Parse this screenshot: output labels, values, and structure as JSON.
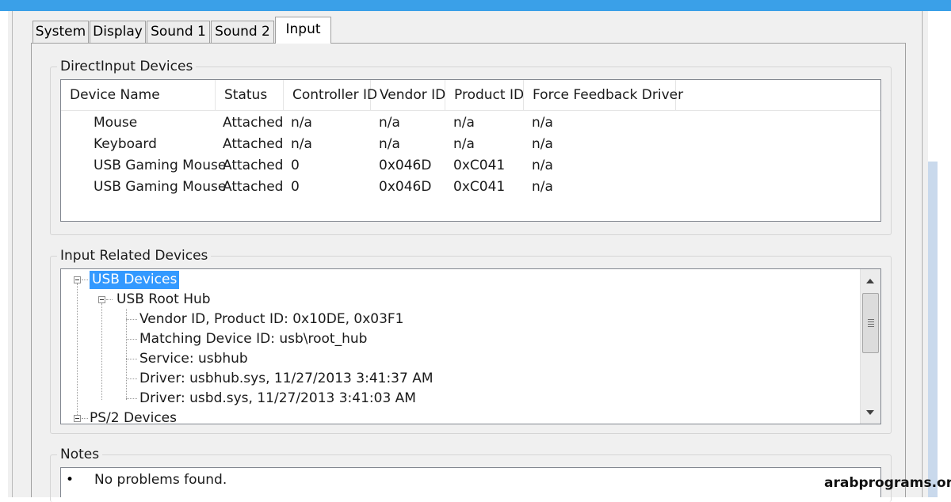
{
  "tabs": [
    {
      "label": "System",
      "active": false
    },
    {
      "label": "Display",
      "active": false
    },
    {
      "label": "Sound 1",
      "active": false
    },
    {
      "label": "Sound 2",
      "active": false
    },
    {
      "label": "Input",
      "active": true
    }
  ],
  "directinput": {
    "group_label": "DirectInput Devices",
    "columns": [
      "Device Name",
      "Status",
      "Controller ID",
      "Vendor ID",
      "Product ID",
      "Force Feedback Driver"
    ],
    "rows": [
      [
        "Mouse",
        "Attached",
        "n/a",
        "n/a",
        "n/a",
        "n/a"
      ],
      [
        "Keyboard",
        "Attached",
        "n/a",
        "n/a",
        "n/a",
        "n/a"
      ],
      [
        "USB Gaming Mouse",
        "Attached",
        "0",
        "0x046D",
        "0xC041",
        "n/a"
      ],
      [
        "USB Gaming Mouse",
        "Attached",
        "0",
        "0x046D",
        "0xC041",
        "n/a"
      ]
    ]
  },
  "input_related": {
    "group_label": "Input Related Devices",
    "nodes": [
      {
        "label": "USB Devices",
        "selected": true
      },
      {
        "label": "USB Root Hub"
      },
      {
        "label": "Vendor ID, Product ID: 0x10DE, 0x03F1"
      },
      {
        "label": "Matching Device ID: usb\\root_hub"
      },
      {
        "label": "Service: usbhub"
      },
      {
        "label": "Driver: usbhub.sys, 11/27/2013 3:41:37 AM"
      },
      {
        "label": "Driver: usbd.sys, 11/27/2013 3:41:03 AM"
      },
      {
        "label": "PS/2 Devices"
      }
    ]
  },
  "notes": {
    "group_label": "Notes",
    "bullet": "•",
    "items": [
      "No problems found."
    ]
  },
  "watermark": "arabprograms.org",
  "colors": {
    "accent_band": "#3aa0e8",
    "selection": "#3399ff",
    "dialog_bg": "#f0f0f0"
  }
}
